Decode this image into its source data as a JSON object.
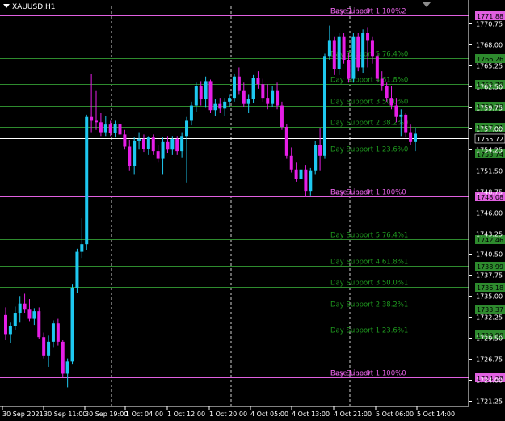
{
  "window": {
    "symbol_title": "XAUUSD,H1"
  },
  "colors": {
    "background": "#000000",
    "bull_candle": "#1ec8f0",
    "bear_candle": "#e61ee6",
    "level_line": "#2e8b2e",
    "base_line": "#e060e0",
    "current_price": "#ffffff",
    "axis": "#ffffff"
  },
  "price_axis": {
    "min": 1720.5,
    "max": 1773.0,
    "ticks": [
      "1770.75",
      "1768.00",
      "1765.25",
      "1762.50",
      "1759.75",
      "1757.00",
      "1754.25",
      "1751.50",
      "1748.75",
      "1746.00",
      "1743.25",
      "1740.50",
      "1737.75",
      "1735.00",
      "1732.25",
      "1729.50",
      "1726.75",
      "1724.00",
      "1721.25"
    ]
  },
  "time_axis": {
    "labels": [
      "30 Sep 2021",
      "30 Sep 11:00",
      "30 Sep 19:00",
      "1 Oct 04:00",
      "1 Oct 12:00",
      "1 Oct 20:00",
      "4 Oct 05:00",
      "4 Oct 13:00",
      "4 Oct 21:00",
      "5 Oct 06:00",
      "5 Oct 14:00"
    ]
  },
  "current_price": {
    "value": 1755.72,
    "label": "1755.72"
  },
  "levels": [
    {
      "price": 1771.88,
      "label": "1771.88",
      "text": "Day Support 1 100%2 / Base Line 0",
      "base": true
    },
    {
      "price": 1766.26,
      "label": "1766.26",
      "text": "Day Support 5 76.4%0",
      "base": false
    },
    {
      "price": 1762.79,
      "label": "1762.79",
      "text": "Day Support 4 61.8%0",
      "base": false
    },
    {
      "price": 1760.0,
      "label": "1760.00",
      "text": "Day Support 3 50.0%0",
      "base": false
    },
    {
      "price": 1757.21,
      "label": "1757.21",
      "text": "Day Support 2 38.2%0",
      "base": false
    },
    {
      "price": 1753.74,
      "label": "1753.74",
      "text": "Day Support 1 23.6%0",
      "base": false
    },
    {
      "price": 1748.08,
      "label": "1748.08",
      "text": "Day Support 1 100%0 / Base Line 0",
      "base": true
    },
    {
      "price": 1742.46,
      "label": "1742.46",
      "text": "Day Support 5 76.4%1",
      "base": false
    },
    {
      "price": 1738.99,
      "label": "1738.99",
      "text": "Day Support 4 61.8%1",
      "base": false
    },
    {
      "price": 1736.18,
      "label": "1736.18",
      "text": "Day Support 3 50.0%1",
      "base": false
    },
    {
      "price": 1733.37,
      "label": "1733.37",
      "text": "Day Support 2 38.2%1",
      "base": false
    },
    {
      "price": 1729.9,
      "label": "1729.90",
      "text": "Day Support 1 23.6%1",
      "base": false
    },
    {
      "price": 1724.28,
      "label": "1724.28",
      "text": "Day Support 1 100%0 / Base Line 0",
      "base": true
    }
  ],
  "chart_data": {
    "type": "candlestick",
    "symbol": "XAUUSD",
    "timeframe": "H1",
    "candles": [
      [
        1732.5,
        1733.5,
        1729.2,
        1730.0
      ],
      [
        1730.0,
        1731.5,
        1728.8,
        1731.0
      ],
      [
        1731.0,
        1733.6,
        1730.5,
        1732.8
      ],
      [
        1732.8,
        1735.0,
        1731.5,
        1734.0
      ],
      [
        1734.0,
        1735.3,
        1732.8,
        1733.2
      ],
      [
        1733.2,
        1734.6,
        1731.7,
        1732.0
      ],
      [
        1732.0,
        1733.4,
        1731.2,
        1733.0
      ],
      [
        1733.0,
        1733.5,
        1729.3,
        1729.6
      ],
      [
        1729.6,
        1730.2,
        1726.8,
        1727.2
      ],
      [
        1727.2,
        1729.8,
        1725.7,
        1729.0
      ],
      [
        1729.0,
        1731.8,
        1728.2,
        1731.4
      ],
      [
        1731.4,
        1732.0,
        1728.5,
        1729.0
      ],
      [
        1729.0,
        1729.2,
        1724.4,
        1724.8
      ],
      [
        1724.8,
        1726.8,
        1723.0,
        1726.4
      ],
      [
        1726.4,
        1736.5,
        1726.0,
        1736.0
      ],
      [
        1736.0,
        1741.2,
        1735.4,
        1740.8
      ],
      [
        1740.8,
        1745.2,
        1740.0,
        1741.8
      ],
      [
        1741.8,
        1758.8,
        1741.0,
        1758.5
      ],
      [
        1758.5,
        1764.2,
        1756.5,
        1758.0
      ],
      [
        1758.0,
        1762.0,
        1756.8,
        1757.8
      ],
      [
        1757.8,
        1759.0,
        1756.0,
        1756.5
      ],
      [
        1756.5,
        1758.6,
        1756.0,
        1757.5
      ],
      [
        1757.5,
        1758.0,
        1756.0,
        1756.4
      ],
      [
        1756.4,
        1758.0,
        1755.8,
        1757.6
      ],
      [
        1757.6,
        1758.0,
        1755.5,
        1756.2
      ],
      [
        1756.2,
        1756.8,
        1754.2,
        1754.6
      ],
      [
        1754.6,
        1755.5,
        1751.5,
        1752.0
      ],
      [
        1752.0,
        1755.8,
        1751.0,
        1755.4
      ],
      [
        1755.4,
        1756.5,
        1754.2,
        1755.6
      ],
      [
        1755.6,
        1756.2,
        1753.9,
        1754.3
      ],
      [
        1754.3,
        1756.0,
        1753.5,
        1755.8
      ],
      [
        1755.8,
        1756.2,
        1753.5,
        1754.0
      ],
      [
        1754.0,
        1754.8,
        1752.5,
        1753.0
      ],
      [
        1753.0,
        1755.8,
        1751.0,
        1755.2
      ],
      [
        1755.2,
        1756.0,
        1753.8,
        1754.2
      ],
      [
        1754.2,
        1756.0,
        1753.5,
        1755.6
      ],
      [
        1755.6,
        1756.0,
        1753.5,
        1754.0
      ],
      [
        1754.0,
        1756.5,
        1753.2,
        1756.0
      ],
      [
        1756.0,
        1758.5,
        1749.9,
        1758.0
      ],
      [
        1758.0,
        1760.5,
        1757.4,
        1760.0
      ],
      [
        1760.0,
        1763.0,
        1759.2,
        1762.6
      ],
      [
        1762.6,
        1763.2,
        1760.0,
        1760.8
      ],
      [
        1760.8,
        1763.8,
        1759.7,
        1763.2
      ],
      [
        1763.2,
        1763.4,
        1759.0,
        1759.4
      ],
      [
        1759.4,
        1760.8,
        1758.6,
        1760.2
      ],
      [
        1760.2,
        1761.0,
        1759.0,
        1759.6
      ],
      [
        1759.6,
        1761.0,
        1758.6,
        1760.5
      ],
      [
        1760.5,
        1761.5,
        1759.8,
        1761.0
      ],
      [
        1761.0,
        1764.2,
        1760.5,
        1763.8
      ],
      [
        1763.8,
        1765.0,
        1761.5,
        1762.0
      ],
      [
        1762.0,
        1763.0,
        1759.8,
        1760.2
      ],
      [
        1760.2,
        1761.5,
        1759.0,
        1760.8
      ],
      [
        1760.8,
        1764.0,
        1760.3,
        1763.6
      ],
      [
        1763.6,
        1764.5,
        1762.2,
        1762.8
      ],
      [
        1762.8,
        1763.5,
        1760.5,
        1761.0
      ],
      [
        1761.0,
        1762.8,
        1759.5,
        1760.2
      ],
      [
        1760.2,
        1762.5,
        1759.8,
        1762.0
      ],
      [
        1762.0,
        1763.0,
        1759.5,
        1760.0
      ],
      [
        1760.0,
        1760.5,
        1756.8,
        1757.2
      ],
      [
        1757.2,
        1757.6,
        1753.0,
        1753.4
      ],
      [
        1753.4,
        1754.5,
        1751.2,
        1751.6
      ],
      [
        1751.6,
        1752.5,
        1750.0,
        1750.4
      ],
      [
        1750.4,
        1752.0,
        1748.6,
        1751.6
      ],
      [
        1751.6,
        1752.2,
        1748.0,
        1748.8
      ],
      [
        1748.8,
        1751.8,
        1748.2,
        1751.5
      ],
      [
        1751.5,
        1755.3,
        1751.0,
        1754.8
      ],
      [
        1754.8,
        1757.0,
        1751.5,
        1753.4
      ],
      [
        1753.4,
        1766.8,
        1753.0,
        1766.5
      ],
      [
        1766.5,
        1770.5,
        1766.0,
        1768.5
      ],
      [
        1768.5,
        1769.0,
        1764.0,
        1764.8
      ],
      [
        1764.8,
        1769.5,
        1764.0,
        1769.0
      ],
      [
        1769.0,
        1769.5,
        1765.5,
        1766.0
      ],
      [
        1766.0,
        1767.0,
        1763.0,
        1763.5
      ],
      [
        1763.5,
        1769.5,
        1763.0,
        1769.0
      ],
      [
        1769.0,
        1769.5,
        1764.5,
        1765.0
      ],
      [
        1765.0,
        1770.0,
        1764.3,
        1769.5
      ],
      [
        1769.5,
        1770.2,
        1765.0,
        1768.5
      ],
      [
        1768.5,
        1769.0,
        1765.5,
        1766.5
      ],
      [
        1766.5,
        1767.0,
        1763.0,
        1763.5
      ],
      [
        1763.5,
        1764.5,
        1762.0,
        1762.5
      ],
      [
        1762.5,
        1763.0,
        1760.5,
        1761.0
      ],
      [
        1761.0,
        1762.5,
        1759.5,
        1760.0
      ],
      [
        1760.0,
        1761.0,
        1757.8,
        1758.5
      ],
      [
        1758.5,
        1759.5,
        1756.0,
        1758.8
      ],
      [
        1758.8,
        1759.0,
        1755.8,
        1756.5
      ],
      [
        1756.5,
        1757.5,
        1754.8,
        1755.2
      ],
      [
        1755.2,
        1757.0,
        1754.0,
        1756.3
      ]
    ]
  }
}
